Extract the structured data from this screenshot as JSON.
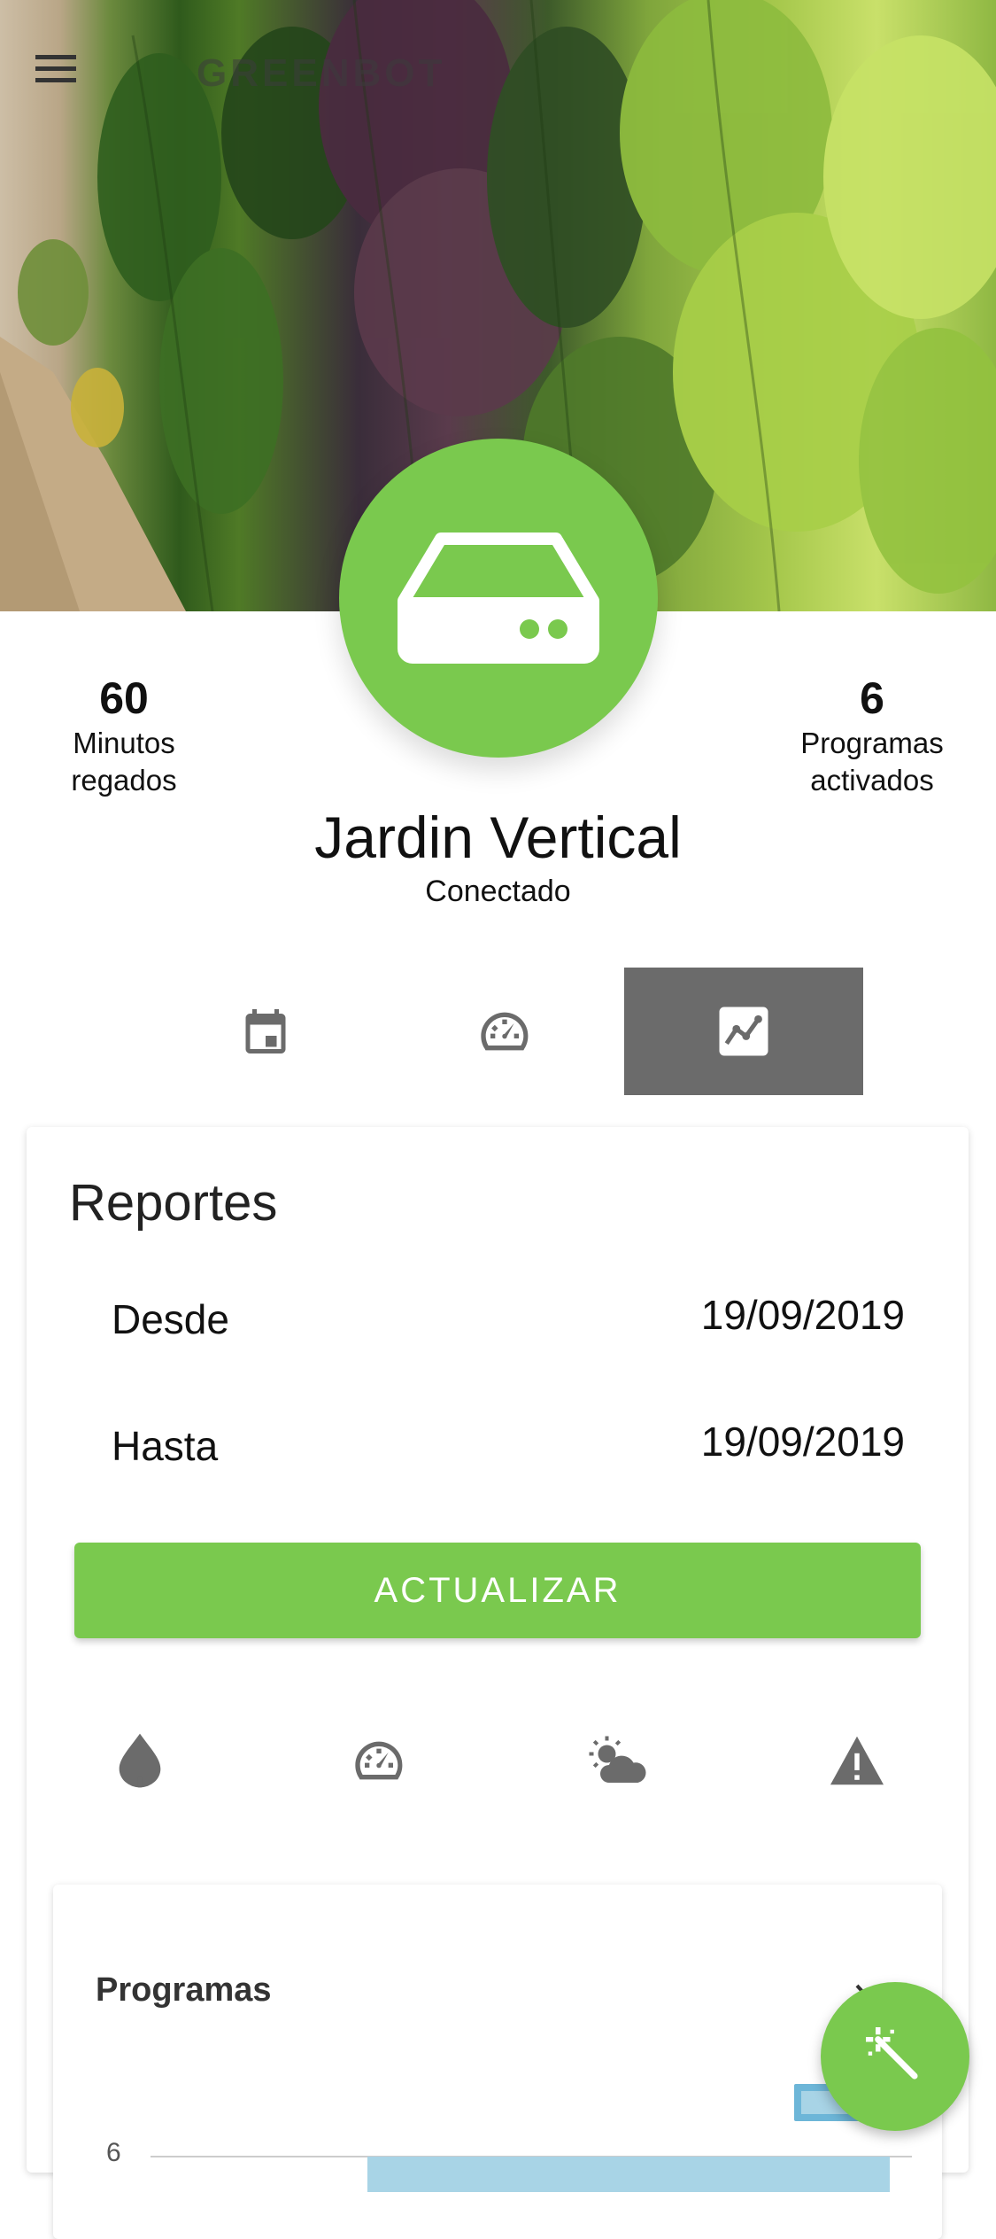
{
  "app": {
    "title": "GREENBOT"
  },
  "device": {
    "name": "Jardin Vertical",
    "status": "Conectado"
  },
  "stats": {
    "left": {
      "value": "60",
      "label_line1": "Minutos",
      "label_line2": "regados"
    },
    "right": {
      "value": "6",
      "label_line1": "Programas",
      "label_line2": "activados"
    }
  },
  "tabs": [
    {
      "icon": "calendar-icon",
      "active": false
    },
    {
      "icon": "gauge-icon",
      "active": false
    },
    {
      "icon": "chart-icon",
      "active": true
    }
  ],
  "report": {
    "title": "Reportes",
    "from_label": "Desde",
    "from_value": "19/09/2019",
    "to_label": "Hasta",
    "to_value": "19/09/2019",
    "update_button": "ACTUALIZAR",
    "categories": [
      "water-drop-icon",
      "gauge-icon",
      "weather-icon",
      "warning-icon"
    ]
  },
  "chart_card": {
    "title": "Programas",
    "first_tick": "6"
  },
  "colors": {
    "accent": "#7ac94e",
    "tab_active": "#6b6b6b",
    "icon_gray": "#6b6b6b",
    "chart_bar": "#a8d4e6",
    "chart_legend": "#6db6d8"
  }
}
